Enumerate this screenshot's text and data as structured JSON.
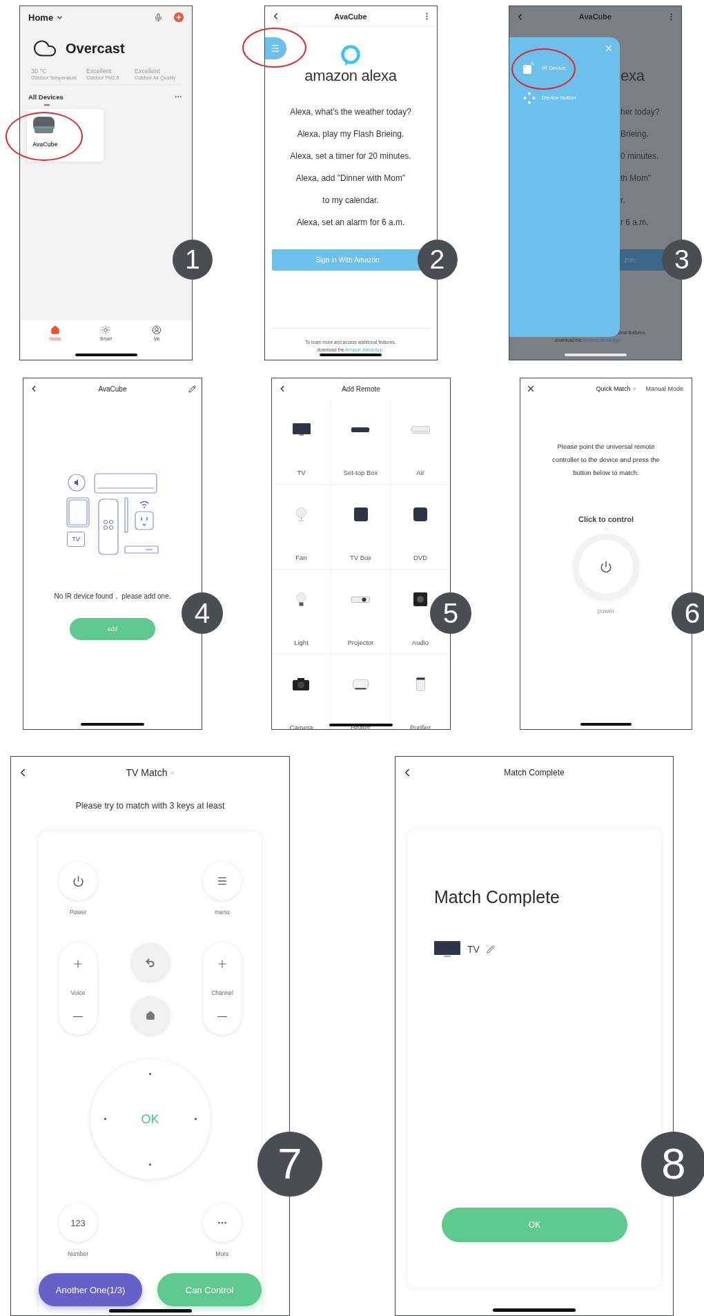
{
  "steps": [
    {
      "number": "1",
      "kind": "home",
      "header": {
        "title": "Home"
      },
      "weather": {
        "condition": "Overcast",
        "stats": [
          {
            "value": "30 °C",
            "label": "Outdoor Temperature"
          },
          {
            "value": "Excellent",
            "label": "Outdoor PM2.5"
          },
          {
            "value": "Excellent",
            "label": "Outdoor Air Quality"
          }
        ]
      },
      "section": {
        "title": "All Devices"
      },
      "devices": [
        {
          "name": "AvaCube",
          "highlighted": true
        }
      ],
      "tabs": [
        {
          "label": "Home",
          "selected": true
        },
        {
          "label": "Smart",
          "selected": false
        },
        {
          "label": "Me",
          "selected": false
        }
      ]
    },
    {
      "number": "2",
      "kind": "alexa",
      "title": "AvaCube",
      "menu_highlighted": true,
      "logo": "amazon alexa",
      "phrases": [
        "Alexa, what's the weather today?",
        "Alexa, play my Flash Brieing.",
        "Alexa, set a timer for 20 minutes.",
        "Alexa, add \"Dinner with Mom\"",
        "to my calendar.",
        "Alexa, set an alarm for 6 a.m."
      ],
      "button": "Sign in With Amazon",
      "footer": {
        "text": "To learn more and access additional features, download the",
        "link": "Amazon Alexa App."
      }
    },
    {
      "number": "3",
      "kind": "drawer",
      "title": "AvaCube",
      "drawer_items": [
        {
          "kind": "ir",
          "label": "IR Device",
          "highlighted": true
        },
        {
          "kind": "buttons",
          "label": "Device Button",
          "highlighted": false
        }
      ],
      "behind": {
        "logo": "exa",
        "phrases": [
          "her today?",
          "Brieing.",
          "0 minutes.",
          "th Mom\"",
          "r.",
          "r 6 a.m."
        ],
        "button": "zon",
        "footer": {
          "line1": "ional features,",
          "line2": "download the",
          "link": "Amazon Alexa App."
        }
      }
    },
    {
      "number": "4",
      "kind": "ir_empty",
      "title": "AvaCube",
      "illustration_label": "TV",
      "message": "No IR device found， please add one.",
      "button": "add"
    },
    {
      "number": "5",
      "kind": "add_remote",
      "title": "Add Remote",
      "categories": [
        {
          "kind": "tv",
          "label": "TV"
        },
        {
          "kind": "settop",
          "label": "Set-top Box"
        },
        {
          "kind": "air",
          "label": "Air"
        },
        {
          "kind": "fan",
          "label": "Fan"
        },
        {
          "kind": "tvbox",
          "label": "TV Box"
        },
        {
          "kind": "dvd",
          "label": "DVD"
        },
        {
          "kind": "light",
          "label": "Light"
        },
        {
          "kind": "projector",
          "label": "Projector"
        },
        {
          "kind": "audio",
          "label": "Audio"
        },
        {
          "kind": "camera",
          "label": "Camera"
        },
        {
          "kind": "heater",
          "label": "Heater"
        },
        {
          "kind": "purifier",
          "label": "Purifier"
        }
      ]
    },
    {
      "number": "6",
      "kind": "quick_match",
      "tabs": [
        {
          "label": "Quick Match",
          "selected": true
        },
        {
          "label": "Manual Mode",
          "selected": false
        }
      ],
      "instructions": "Please point the universal remote controller to the device and press the button below to match.",
      "prompt": "Click to control",
      "power_label": "power"
    },
    {
      "number": "7",
      "kind": "tv_match",
      "title": "TV Match",
      "subtitle": "Please try to match with 3 keys at least",
      "keys": {
        "power": "Power",
        "menu": "menu",
        "volume": "Voice",
        "channel": "Channel",
        "ok": "OK",
        "number_face": "123",
        "number": "Number",
        "more": "More"
      },
      "actions": [
        {
          "kind": "secondary",
          "label": "Another One(1/3)"
        },
        {
          "kind": "primary",
          "label": "Can Control"
        }
      ]
    },
    {
      "number": "8",
      "kind": "complete",
      "title": "Match Complete",
      "heading": "Match Complete",
      "device": "TV",
      "button": "OK"
    }
  ]
}
